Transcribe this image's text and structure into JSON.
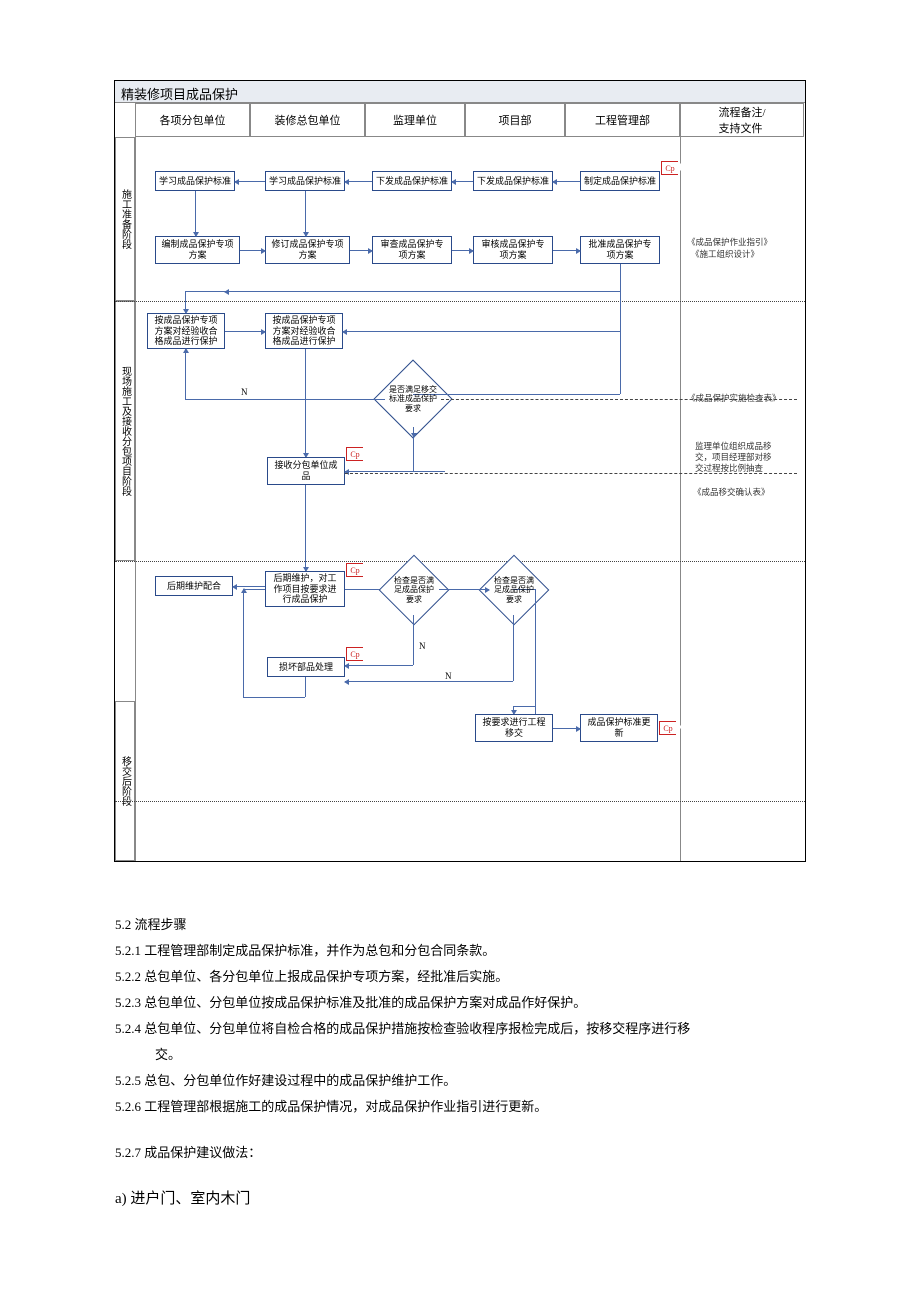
{
  "title": "精装修项目成品保护",
  "lanes": {
    "l1": "各项分包单位",
    "l2": "装修总包单位",
    "l3": "监理单位",
    "l4": "项目部",
    "l5": "工程管理部",
    "l6": "流程备注/\n支持文件"
  },
  "phases": {
    "p1": "施工准备阶段",
    "p2": "现场施工及接收分包项目阶段",
    "p3": "移交后阶段"
  },
  "boxes": {
    "b11": "学习成品保护标准",
    "b12": "学习成品保护标准",
    "b13": "下发成品保护标准",
    "b14": "下发成品保护标准",
    "b15": "制定成品保护标准",
    "b21": "编制成品保护专项\n方案",
    "b22": "修订成品保护专项\n方案",
    "b23": "审查成品保护专\n项方案",
    "b24": "审核成品保护专\n项方案",
    "b25": "批准成品保护专\n项方案",
    "b31": "按成品保护专项\n方案对经验收合\n格成品进行保护",
    "b32": "按成品保护专项\n方案对经验收合\n格成品进行保护",
    "d1": "是否满足移交\n标准成品保护\n要求",
    "b42": "接收分包单位成\n品",
    "b51": "后期维护配合",
    "b52": "后期维护，对工\n作项目按要求进\n行成品保护",
    "d2": "检查是否满\n足成品保护\n要求",
    "d3": "检查是否满\n足成品保护\n要求",
    "b62": "损坏部品处理",
    "b74": "按要求进行工程\n移交",
    "b75": "成品保护标准更\n新"
  },
  "notes": {
    "n1a": "《成品保护作业指引》",
    "n1b": "《施工组织设计》",
    "n2": "《成品保护实施检查表》",
    "n3": "监理单位组织成品移\n交，项目经理部对移\n交过程按比例抽查",
    "n4": "《成品移交确认表》"
  },
  "labels": {
    "N": "N",
    "cp": "Cp"
  },
  "text": {
    "s52": "5.2 流程步骤",
    "s521": "5.2.1 工程管理部制定成品保护标准，并作为总包和分包合同条款。",
    "s522": "5.2.2  总包单位、各分包单位上报成品保护专项方案，经批准后实施。",
    "s523": "5.2.3 总包单位、分包单位按成品保护标准及批准的成品保护方案对成品作好保护。",
    "s524a": "5.2.4 总包单位、分包单位将自检合格的成品保护措施按检查验收程序报检完成后，按移交程序进行移",
    "s524b": "交。",
    "s525": "5.2.5 总包、分包单位作好建设过程中的成品保护维护工作。",
    "s526": "5.2.6 工程管理部根据施工的成品保护情况，对成品保护作业指引进行更新。",
    "s527": "5.2.7 成品保护建议做法：",
    "sa": "a)  进户门、室内木门"
  }
}
